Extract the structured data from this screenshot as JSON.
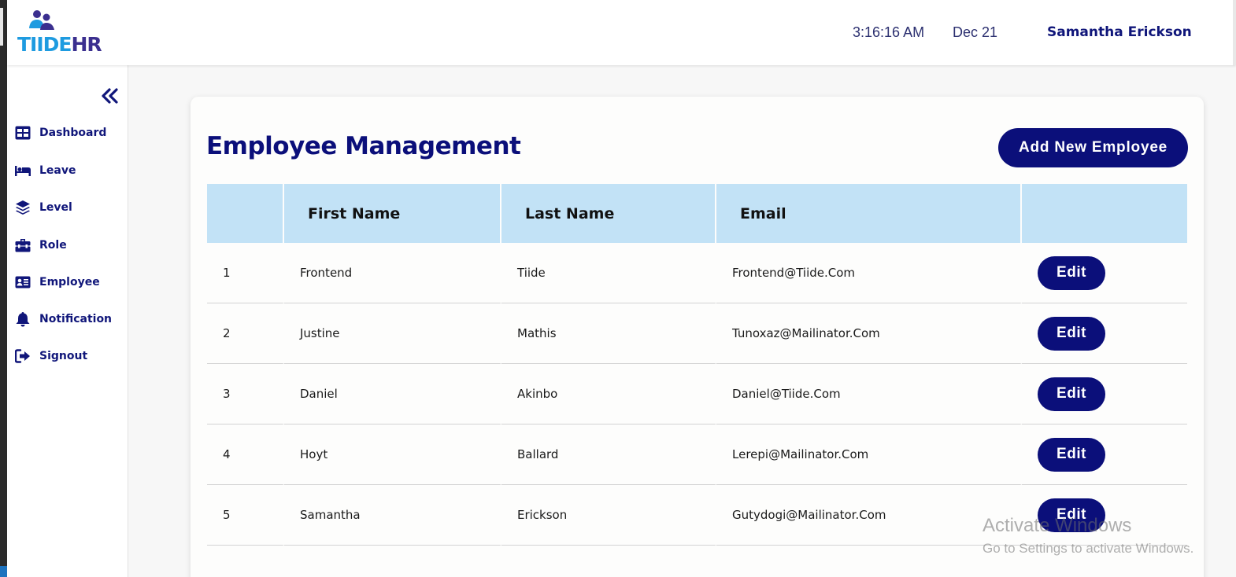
{
  "header": {
    "logo_part1": "TIIDE",
    "logo_part2": "HR",
    "time": "3:16:16 AM",
    "date": "Dec 21",
    "user_name": "Samantha Erickson"
  },
  "sidebar": {
    "items": [
      {
        "label": "Dashboard",
        "icon": "dashboard-icon"
      },
      {
        "label": "Leave",
        "icon": "bed-icon"
      },
      {
        "label": "Level",
        "icon": "layers-icon"
      },
      {
        "label": "Role",
        "icon": "toolbox-icon"
      },
      {
        "label": "Employee",
        "icon": "id-card-icon"
      },
      {
        "label": "Notification",
        "icon": "bell-icon"
      },
      {
        "label": "Signout",
        "icon": "sign-out-icon"
      }
    ]
  },
  "main": {
    "title": "Employee Management",
    "add_button_label": "Add New Employee",
    "table": {
      "headers": [
        "",
        "First Name",
        "Last Name",
        "Email",
        ""
      ],
      "rows": [
        {
          "num": "1",
          "first": "Frontend",
          "last": "Tiide",
          "email": "Frontend@Tiide.Com",
          "action": "Edit"
        },
        {
          "num": "2",
          "first": "Justine",
          "last": "Mathis",
          "email": "Tunoxaz@Mailinator.Com",
          "action": "Edit"
        },
        {
          "num": "3",
          "first": "Daniel",
          "last": "Akinbo",
          "email": "Daniel@Tiide.Com",
          "action": "Edit"
        },
        {
          "num": "4",
          "first": "Hoyt",
          "last": "Ballard",
          "email": "Lerepi@Mailinator.Com",
          "action": "Edit"
        },
        {
          "num": "5",
          "first": "Samantha",
          "last": "Erickson",
          "email": "Gutydogi@Mailinator.Com",
          "action": "Edit"
        }
      ]
    }
  },
  "watermark": {
    "title": "Activate Windows",
    "subtitle": "Go to Settings to activate Windows."
  },
  "colors": {
    "brand_navy": "#0b0f7a",
    "header_blue": "#c2e2f6",
    "logo_light_blue": "#1e9be0",
    "logo_purple": "#3b2f8f"
  }
}
